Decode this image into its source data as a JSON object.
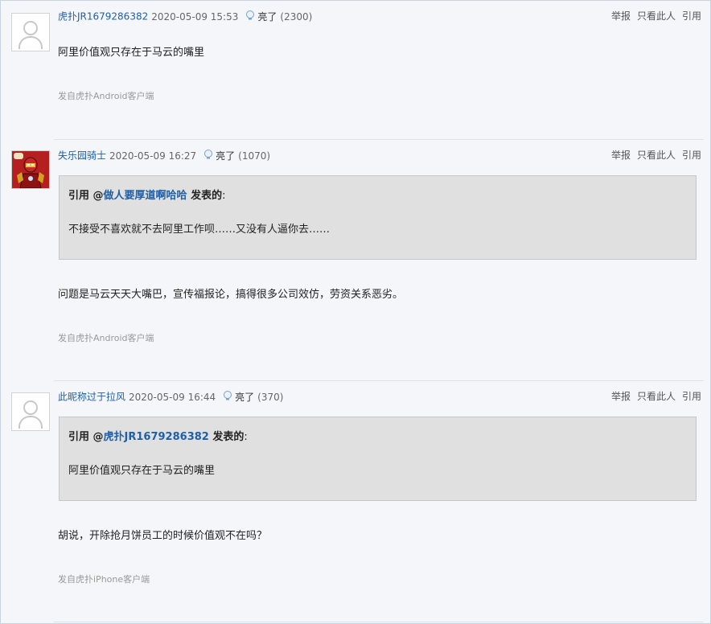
{
  "posts": [
    {
      "user": "虎扑JR1679286382",
      "time": "2020-05-09 15:53",
      "light_label": "亮了",
      "light_count": "(2300)",
      "ops": {
        "report": "举报",
        "only_this": "只看此人",
        "quote": "引用"
      },
      "content": "阿里价值观只存在于马云的嘴里",
      "source": "发自虎扑Android客户端"
    },
    {
      "user": "失乐园骑士",
      "time": "2020-05-09 16:27",
      "light_label": "亮了",
      "light_count": "(1070)",
      "ops": {
        "report": "举报",
        "only_this": "只看此人",
        "quote": "引用"
      },
      "quote": {
        "prefix": "引用 @",
        "user": "做人要厚道啊哈哈",
        "suffix": " 发表的",
        "colon": ":",
        "text": "不接受不喜欢就不去阿里工作呗……又没有人逼你去……"
      },
      "content": "问题是马云天天大嘴巴，宣传福报论，搞得很多公司效仿，劳资关系恶劣。",
      "source": "发自虎扑Android客户端"
    },
    {
      "user": "此昵称过于拉风",
      "time": "2020-05-09 16:44",
      "light_label": "亮了",
      "light_count": "(370)",
      "ops": {
        "report": "举报",
        "only_this": "只看此人",
        "quote": "引用"
      },
      "quote": {
        "prefix": "引用 @",
        "user": "虎扑JR1679286382",
        "suffix": " 发表的",
        "colon": ":",
        "text": "阿里价值观只存在于马云的嘴里"
      },
      "content": "胡说，开除抢月饼员工的时候价值观不在吗？",
      "source": "发自虎扑iPhone客户端"
    }
  ],
  "colors": {
    "link": "#1f5fa8",
    "quote_bg": "#e0e0e0",
    "page_bg": "#f4f6f9"
  },
  "icons": {
    "avatar_default": "user-silhouette-icon",
    "avatar_custom": "ironman-avatar-icon",
    "light": "lightbulb-icon"
  }
}
